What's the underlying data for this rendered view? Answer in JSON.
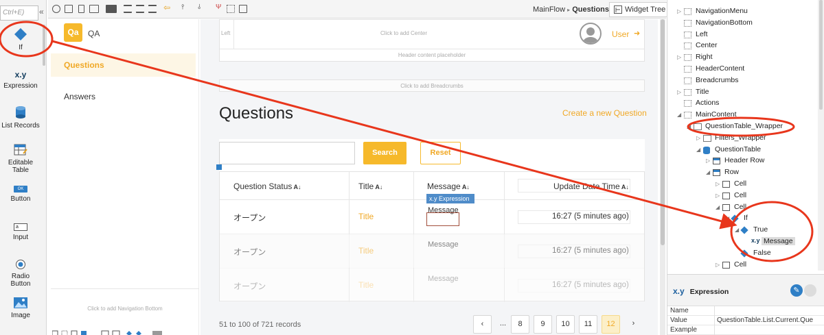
{
  "toolbox": {
    "search_placeholder": "Ctrl+E)",
    "collapse_icon": "double-chevron-left-icon",
    "items": [
      {
        "label": "If",
        "icon": "if-diamond-icon"
      },
      {
        "label": "Expression",
        "icon": "expression-xy-icon",
        "glyph": "x.y"
      },
      {
        "label": "List Records",
        "icon": "database-icon"
      },
      {
        "label": "Editable Table",
        "icon": "editable-table-icon"
      },
      {
        "label": "Button",
        "icon": "button-icon",
        "glyph": "OK"
      },
      {
        "label": "Input",
        "icon": "input-icon",
        "glyph": "a"
      },
      {
        "label": "Radio Button",
        "icon": "radio-button-icon"
      },
      {
        "label": "Image",
        "icon": "image-icon"
      }
    ]
  },
  "topbar": {
    "breadcrumb_flow": "MainFlow",
    "breadcrumb_separator": "▸",
    "breadcrumb_screen": "Questions",
    "widget_tree_tab": "Widget Tree"
  },
  "app": {
    "logo_text": "Qa",
    "name": "QA",
    "nav_items": [
      "Questions",
      "Answers"
    ],
    "nav_bottom_placeholder": "Click to add Navigation Bottom"
  },
  "header": {
    "left_label": "Left",
    "center_placeholder": "Click to add Center",
    "content_placeholder": "Header content placeholder",
    "user_label": "User"
  },
  "breadcrumbs_placeholder": "Click to add Breadcrumbs",
  "page": {
    "title": "Questions",
    "create_link": "Create a new Question",
    "search_value": "",
    "search_button": "Search",
    "reset_button": "Reset"
  },
  "table": {
    "headers": [
      "Question Status",
      "Title",
      "Message",
      "Update Date Time"
    ],
    "expression_tag": "x.y  Expression",
    "rows": [
      {
        "status": "オープン",
        "title": "Title",
        "message": "Message",
        "updated": "16:27 (5 minutes ago)"
      },
      {
        "status": "オープン",
        "title": "Title",
        "message": "Message",
        "updated": "16:27 (5 minutes ago)"
      },
      {
        "status": "オープン",
        "title": "Title",
        "message": "Message",
        "updated": "16:27 (5 minutes ago)"
      }
    ]
  },
  "pagination": {
    "summary": "51 to 100 of 721 records",
    "prev": "‹",
    "ellipsis": "...",
    "pages": [
      "8",
      "9",
      "10",
      "11",
      "12"
    ],
    "active_page": "12",
    "next": "›"
  },
  "widget_tree": {
    "nodes": [
      {
        "label": "NavigationMenu",
        "depth": 0,
        "icon": "placeholder-icon",
        "expander": "▷"
      },
      {
        "label": "NavigationBottom",
        "depth": 0,
        "icon": "placeholder-icon",
        "expander": ""
      },
      {
        "label": "Left",
        "depth": 0,
        "icon": "placeholder-icon",
        "expander": ""
      },
      {
        "label": "Center",
        "depth": 0,
        "icon": "placeholder-icon",
        "expander": ""
      },
      {
        "label": "Right",
        "depth": 0,
        "icon": "placeholder-icon",
        "expander": "▷"
      },
      {
        "label": "HeaderContent",
        "depth": 0,
        "icon": "placeholder-icon",
        "expander": ""
      },
      {
        "label": "Breadcrumbs",
        "depth": 0,
        "icon": "placeholder-icon",
        "expander": ""
      },
      {
        "label": "Title",
        "depth": 0,
        "icon": "placeholder-icon",
        "expander": "▷"
      },
      {
        "label": "Actions",
        "depth": 0,
        "icon": "placeholder-icon",
        "expander": ""
      },
      {
        "label": "MainContent",
        "depth": 0,
        "icon": "placeholder-icon",
        "expander": "◢"
      },
      {
        "label": "QuestionTable_Wrapper",
        "depth": 1,
        "icon": "container-icon",
        "expander": "◢"
      },
      {
        "label": "Filters_Wrapper",
        "depth": 2,
        "icon": "container-icon",
        "expander": "▷"
      },
      {
        "label": "QuestionTable",
        "depth": 2,
        "icon": "database-icon",
        "expander": "◢"
      },
      {
        "label": "Header Row",
        "depth": 3,
        "icon": "table-icon",
        "expander": "▷"
      },
      {
        "label": "Row",
        "depth": 3,
        "icon": "table-icon",
        "expander": "◢"
      },
      {
        "label": "Cell",
        "depth": 4,
        "icon": "cell-icon",
        "expander": "▷"
      },
      {
        "label": "Cell",
        "depth": 4,
        "icon": "cell-icon",
        "expander": "▷"
      },
      {
        "label": "Cell",
        "depth": 4,
        "icon": "cell-icon",
        "expander": "◢"
      },
      {
        "label": "If",
        "depth": 5,
        "icon": "if-diamond-icon",
        "expander": "◢"
      },
      {
        "label": "True",
        "depth": 6,
        "icon": "branch-icon",
        "expander": "◢"
      },
      {
        "label": "Message",
        "depth": 7,
        "icon": "expression-xy-icon",
        "expander": ""
      },
      {
        "label": "False",
        "depth": 6,
        "icon": "branch-icon",
        "expander": ""
      },
      {
        "label": "Cell",
        "depth": 4,
        "icon": "cell-icon",
        "expander": "▷"
      }
    ],
    "selected": "Message"
  },
  "properties": {
    "icon_glyph": "x.y",
    "title": "Expression",
    "rows": [
      {
        "key": "Name",
        "value": ""
      },
      {
        "key": "Value",
        "value": "QuestionTable.List.Current.Que"
      },
      {
        "key": "Example",
        "value": ""
      }
    ]
  },
  "colors": {
    "accent": "#f6b92b",
    "annotation": "#e8361c",
    "tree_blue": "#2f7fc6"
  }
}
